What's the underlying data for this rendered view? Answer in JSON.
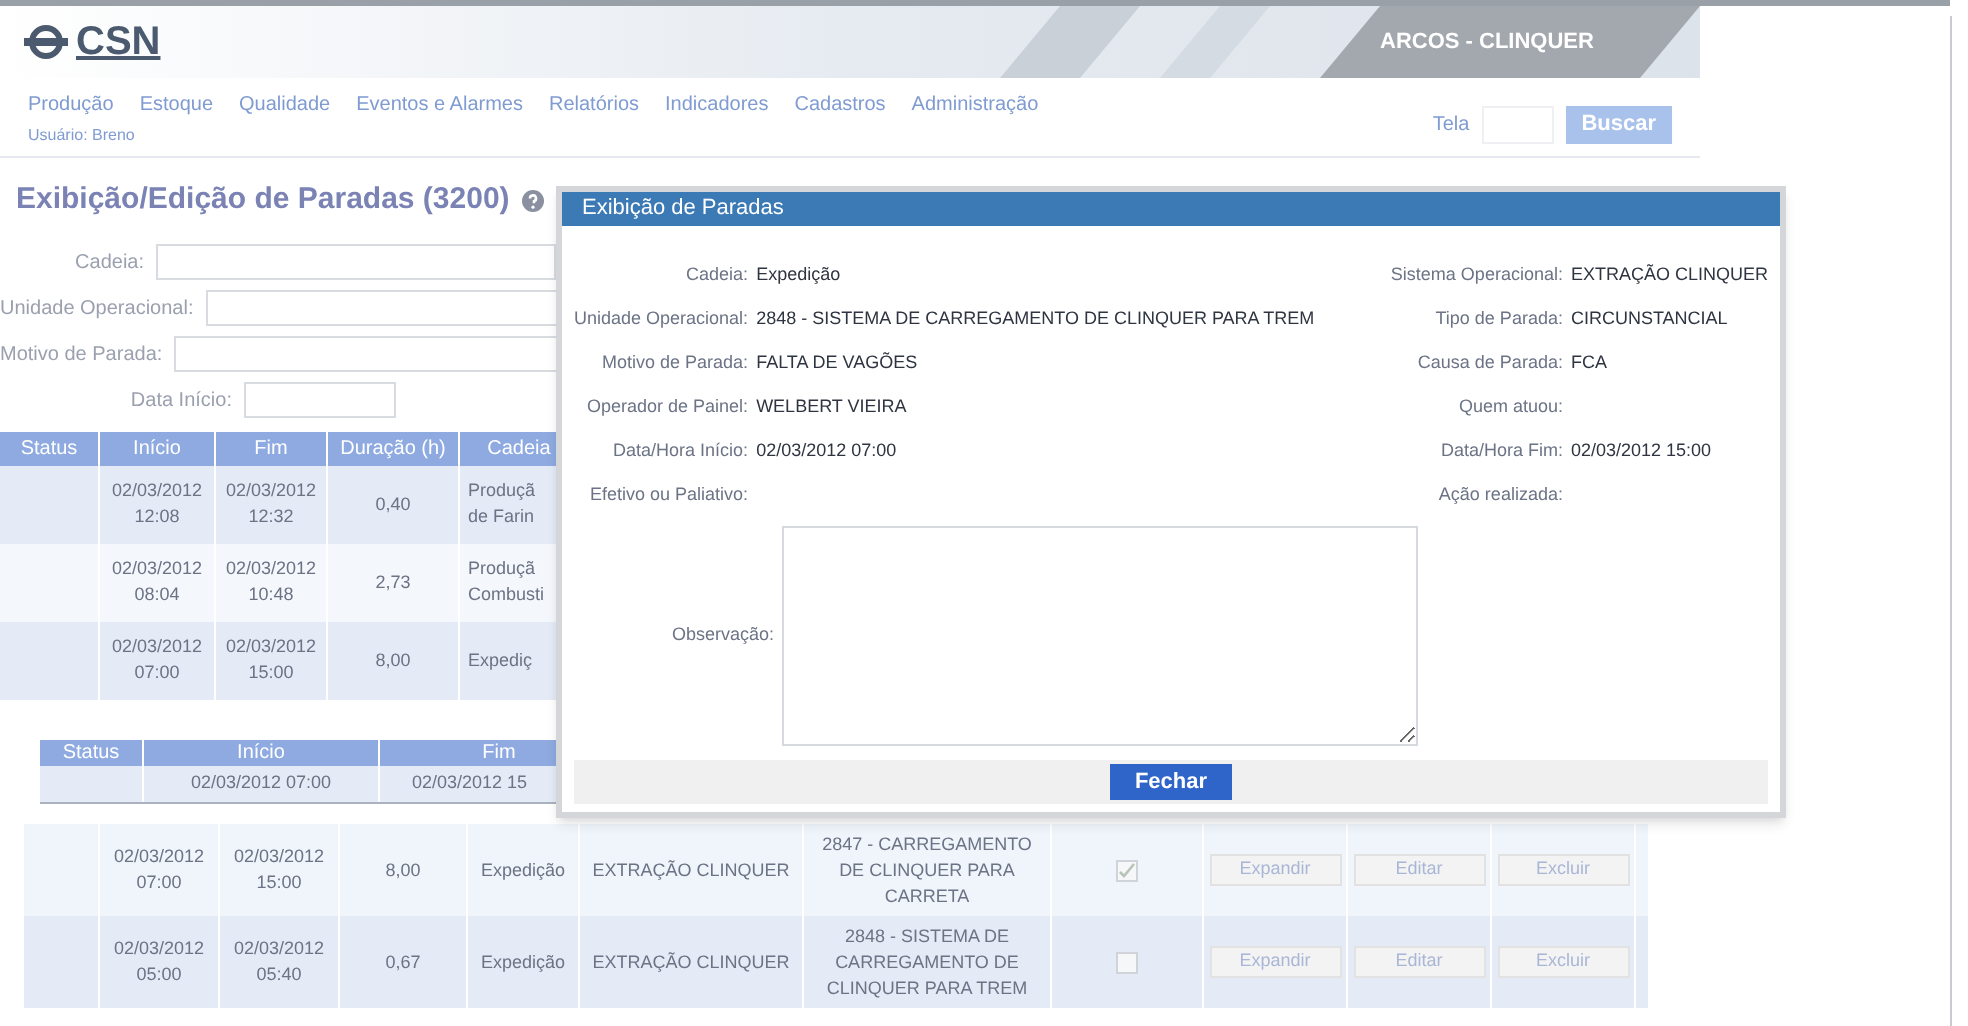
{
  "header": {
    "logo": "CSN",
    "site": "ARCOS - CLINQUER"
  },
  "nav": [
    "Produção",
    "Estoque",
    "Qualidade",
    "Eventos e Alarmes",
    "Relatórios",
    "Indicadores",
    "Cadastros",
    "Administração"
  ],
  "user": "Usuário: Breno",
  "search": {
    "label": "Tela",
    "button": "Buscar"
  },
  "page_title": "Exibição/Edição de Paradas (3200)",
  "filters": [
    {
      "label": "Cadeia:",
      "kind": "wide"
    },
    {
      "label": "Unidade Operacional:",
      "kind": "wide"
    },
    {
      "label": "Motivo de Parada:",
      "kind": "wide"
    },
    {
      "label": "Data Início:",
      "kind": "short"
    }
  ],
  "table": {
    "columns": [
      "Status",
      "Início",
      "Fim",
      "Duração (h)",
      "Cadeia"
    ],
    "rows": [
      {
        "inicio": "02/03/2012 12:08",
        "fim": "02/03/2012 12:32",
        "duracao": "0,40",
        "cadeia": [
          "Produçã",
          "de Farin"
        ]
      },
      {
        "inicio": "02/03/2012 08:04",
        "fim": "02/03/2012 10:48",
        "duracao": "2,73",
        "cadeia": [
          "Produçã",
          "Combusti"
        ]
      },
      {
        "inicio": "02/03/2012 07:00",
        "fim": "02/03/2012 15:00",
        "duracao": "8,00",
        "cadeia": [
          "Expediç"
        ]
      }
    ]
  },
  "detail_table": {
    "columns": [
      "Status",
      "Início",
      "Fim"
    ],
    "row": {
      "inicio": "02/03/2012 07:00",
      "fim": "02/03/2012 15"
    }
  },
  "stops": [
    {
      "inicio": "02/03/2012 07:00",
      "fim": "02/03/2012 15:00",
      "duracao": "8,00",
      "cadeia": "Expedição",
      "sistema": "EXTRAÇÃO CLINQUER",
      "unidade": "2847 - CARREGAMENTO DE CLINQUER PARA CARRETA",
      "checked": true,
      "actions": [
        "Expandir",
        "Editar",
        "Excluir"
      ]
    },
    {
      "inicio": "02/03/2012 05:00",
      "fim": "02/03/2012 05:40",
      "duracao": "0,67",
      "cadeia": "Expedição",
      "sistema": "EXTRAÇÃO CLINQUER",
      "unidade": "2848 - SISTEMA DE CARREGAMENTO DE CLINQUER PARA TREM",
      "checked": false,
      "actions": [
        "Expandir",
        "Editar",
        "Excluir"
      ]
    }
  ],
  "dialog": {
    "title": "Exibição de Paradas",
    "rows": [
      [
        {
          "label": "Cadeia:",
          "value": "Expedição"
        },
        {
          "label": "Sistema Operacional:",
          "value": "EXTRAÇÃO CLINQUER"
        }
      ],
      [
        {
          "label": "Unidade Operacional:",
          "value": "2848 - SISTEMA DE CARREGAMENTO DE CLINQUER PARA TREM"
        },
        {
          "label": "Tipo de Parada:",
          "value": "CIRCUNSTANCIAL"
        }
      ],
      [
        {
          "label": "Motivo de Parada:",
          "value": "FALTA DE VAGÕES"
        },
        {
          "label": "Causa de Parada:",
          "value": "FCA"
        }
      ],
      [
        {
          "label": "Operador de Painel:",
          "value": "WELBERT VIEIRA"
        },
        {
          "label": "Quem atuou:"
        }
      ],
      [
        {
          "label": "Data/Hora Início:",
          "value": "02/03/2012 07:00"
        },
        {
          "label": "Data/Hora Fim:",
          "value": "02/03/2012 15:00"
        }
      ],
      [
        {
          "label": "Efetivo ou Paliativo:"
        },
        {
          "label": "Ação realizada:"
        }
      ]
    ],
    "observacao_label": "Observação:",
    "button": "Fechar"
  }
}
